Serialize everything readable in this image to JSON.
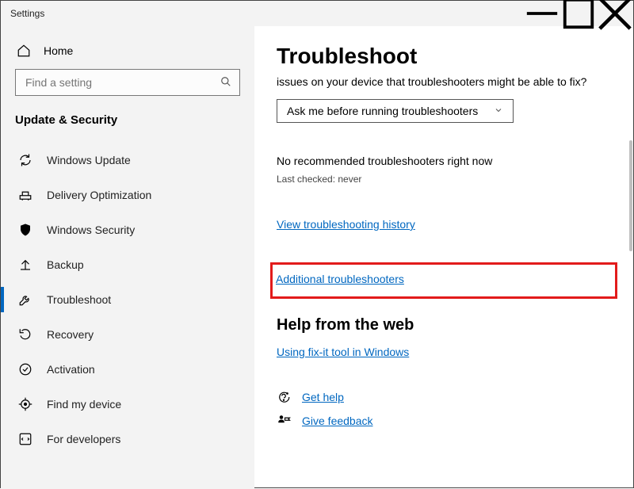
{
  "window": {
    "title": "Settings"
  },
  "sidebar": {
    "home_label": "Home",
    "search_placeholder": "Find a setting",
    "section_title": "Update & Security",
    "items": [
      {
        "label": "Windows Update"
      },
      {
        "label": "Delivery Optimization"
      },
      {
        "label": "Windows Security"
      },
      {
        "label": "Backup"
      },
      {
        "label": "Troubleshoot",
        "selected": true
      },
      {
        "label": "Recovery"
      },
      {
        "label": "Activation"
      },
      {
        "label": "Find my device"
      },
      {
        "label": "For developers"
      }
    ]
  },
  "main": {
    "heading": "Troubleshoot",
    "subtitle": "issues on your device that troubleshooters might be able to fix?",
    "dropdown_value": "Ask me before running troubleshooters",
    "no_recommended": "No recommended troubleshooters right now",
    "last_checked": "Last checked: never",
    "link_history": "View troubleshooting history",
    "link_additional": "Additional troubleshooters",
    "help_heading": "Help from the web",
    "link_fixit": "Using fix-it tool in Windows",
    "get_help_label": "Get help",
    "give_feedback_label": "Give feedback"
  }
}
